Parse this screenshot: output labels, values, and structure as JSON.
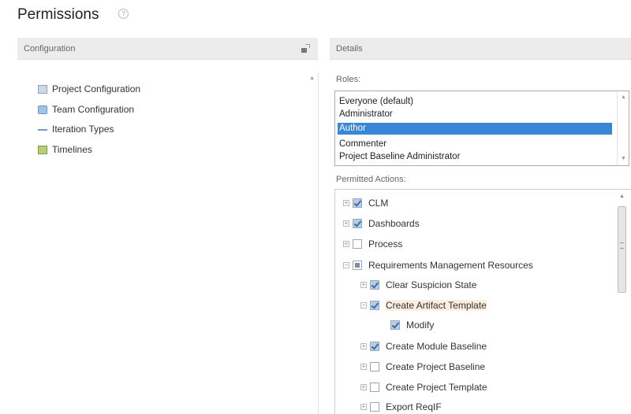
{
  "page": {
    "title": "Permissions",
    "help_glyph": "?"
  },
  "configuration": {
    "header": "Configuration",
    "items": [
      {
        "label": "Project Configuration",
        "icon": "project-config-icon"
      },
      {
        "label": "Team Configuration",
        "icon": "team-config-icon"
      },
      {
        "label": "Iteration Types",
        "icon": "iteration-types-icon"
      },
      {
        "label": "Timelines",
        "icon": "timelines-icon"
      }
    ]
  },
  "details": {
    "header": "Details",
    "roles_label": "Roles:",
    "roles": [
      "Everyone (default)",
      "Administrator",
      "Author",
      "Commenter",
      "Project Baseline Administrator"
    ],
    "selected_role": "Author",
    "permitted_label": "Permitted Actions:",
    "actions": [
      {
        "label": "CLM",
        "level": 0,
        "state": "checked"
      },
      {
        "label": "Dashboards",
        "level": 0,
        "state": "checked"
      },
      {
        "label": "Process",
        "level": 0,
        "state": "unchecked"
      },
      {
        "label": "Requirements Management Resources",
        "level": 0,
        "state": "partial"
      },
      {
        "label": "Clear Suspicion State",
        "level": 1,
        "state": "checked"
      },
      {
        "label": "Create Artifact Template",
        "level": 1,
        "state": "checked"
      },
      {
        "label": "Modify",
        "level": 2,
        "state": "checked"
      },
      {
        "label": "Create Module Baseline",
        "level": 1,
        "state": "checked"
      },
      {
        "label": "Create Project Baseline",
        "level": 1,
        "state": "unchecked"
      },
      {
        "label": "Create Project Template",
        "level": 1,
        "state": "unchecked"
      },
      {
        "label": "Export ReqIF",
        "level": 1,
        "state": "unchecked"
      }
    ]
  },
  "colors": {
    "selection": "#3a86d6",
    "highlight": "#fbeee0"
  }
}
